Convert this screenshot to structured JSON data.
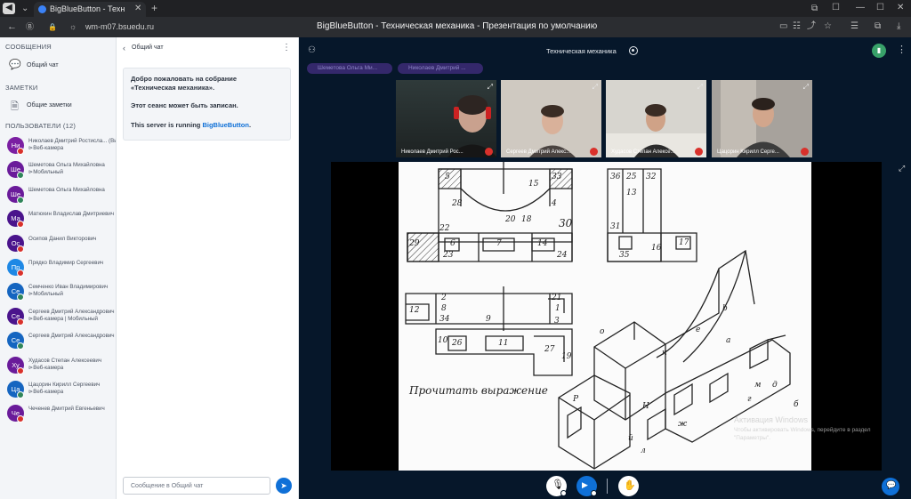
{
  "browser": {
    "tab_title": "BigBlueButton - Техн",
    "url": "wm-m07.bsuedu.ru",
    "page_title": "BigBlueButton - Техническая механика - Презентация по умолчанию"
  },
  "sidebar": {
    "messages_title": "СООБЩЕНИЯ",
    "public_chat": "Общий чат",
    "notes_title": "ЗАМЕТКИ",
    "shared_notes": "Общие заметки",
    "users_title": "ПОЛЬЗОВАТЕЛИ (12)",
    "users": [
      {
        "initials": "Ни",
        "name": "Николаев Дмитрий Ростисла...",
        "you": "(Вы)",
        "sub": "Веб-камера",
        "color": "#7b1fa2"
      },
      {
        "initials": "Ше",
        "name": "Шеметова Ольга Михайловна",
        "sub": "Мобильный",
        "color": "#6a1b9a"
      },
      {
        "initials": "Ше",
        "name": "Шеметова Ольга Михайловна",
        "sub": "",
        "color": "#6a1b9a"
      },
      {
        "initials": "Ма",
        "name": "Матюхин Владислав Дмитриевич",
        "sub": "",
        "color": "#4a148c"
      },
      {
        "initials": "Ос",
        "name": "Осипов Данил Викторович",
        "sub": "",
        "color": "#4a148c"
      },
      {
        "initials": "Пр",
        "name": "Прядко Владимир Сергеевич",
        "sub": "",
        "color": "#1e88e5"
      },
      {
        "initials": "Се",
        "name": "Семченко Иван Владимирович",
        "sub": "Мобильный",
        "color": "#1565c0"
      },
      {
        "initials": "Се",
        "name": "Сергеев Дмитрий Александрович",
        "sub": "Веб-камера | Мобильный",
        "color": "#4a148c"
      },
      {
        "initials": "Се",
        "name": "Сергеев Дмитрий Александрович",
        "sub": "",
        "color": "#1565c0"
      },
      {
        "initials": "Ху",
        "name": "Худасов Степан Алексеевич",
        "sub": "Веб-камера",
        "color": "#6a1b9a"
      },
      {
        "initials": "Ца",
        "name": "Цацорин Кирилл Сергеевич",
        "sub": "Веб-камера",
        "color": "#1565c0"
      },
      {
        "initials": "Че",
        "name": "Чеченев Дмитрий Евгеньевич",
        "sub": "",
        "color": "#6a1b9a"
      }
    ]
  },
  "chat": {
    "header": "Общий чат",
    "welcome_line": "Добро пожаловать на собрание «Техническая механика».",
    "recorded": "Этот сеанс может быть записан.",
    "running_prefix": "This server is running ",
    "running_link": "BigBlueButton",
    "running_suffix": ".",
    "input_placeholder": "Сообщение в Общий чат"
  },
  "main": {
    "meeting_title": "Техническая механика",
    "talking": [
      "Шеметова Ольга Ми...",
      "Николаев Дмитрий ..."
    ],
    "videos": [
      {
        "label": "Николаев Дмитрий Рос..."
      },
      {
        "label": "Сергеев Дмитрий Алекс..."
      },
      {
        "label": "Худасов Степан Алексе..."
      },
      {
        "label": "Цацорин Кирилл Серге..."
      }
    ],
    "slide": {
      "handwriting": "Прочитать выражение",
      "labels_top": [
        "5",
        "33",
        "15",
        "28",
        "4",
        "20",
        "18",
        "30",
        "22",
        "29",
        "6",
        "7",
        "14",
        "23",
        "24"
      ],
      "labels_right": [
        "36",
        "25",
        "32",
        "13",
        "31",
        "35",
        "16",
        "17"
      ],
      "labels_mid": [
        "2",
        "21",
        "12",
        "8",
        "1",
        "34",
        "9",
        "3",
        "10",
        "26",
        "11",
        "27",
        "19"
      ],
      "labels_iso": [
        "о",
        "b",
        "к",
        "е",
        "а",
        "м",
        "г",
        "д",
        "б",
        "Н",
        "Р",
        "й",
        "л",
        "ж"
      ]
    },
    "watermark_title": "Активация Windows",
    "watermark_sub": "Чтобы активировать Windows, перейдите в раздел \"Параметры\"."
  },
  "colors": {
    "accent": "#0f70d7",
    "dark_bg": "#06172a",
    "talking_pill": "#34286b"
  }
}
